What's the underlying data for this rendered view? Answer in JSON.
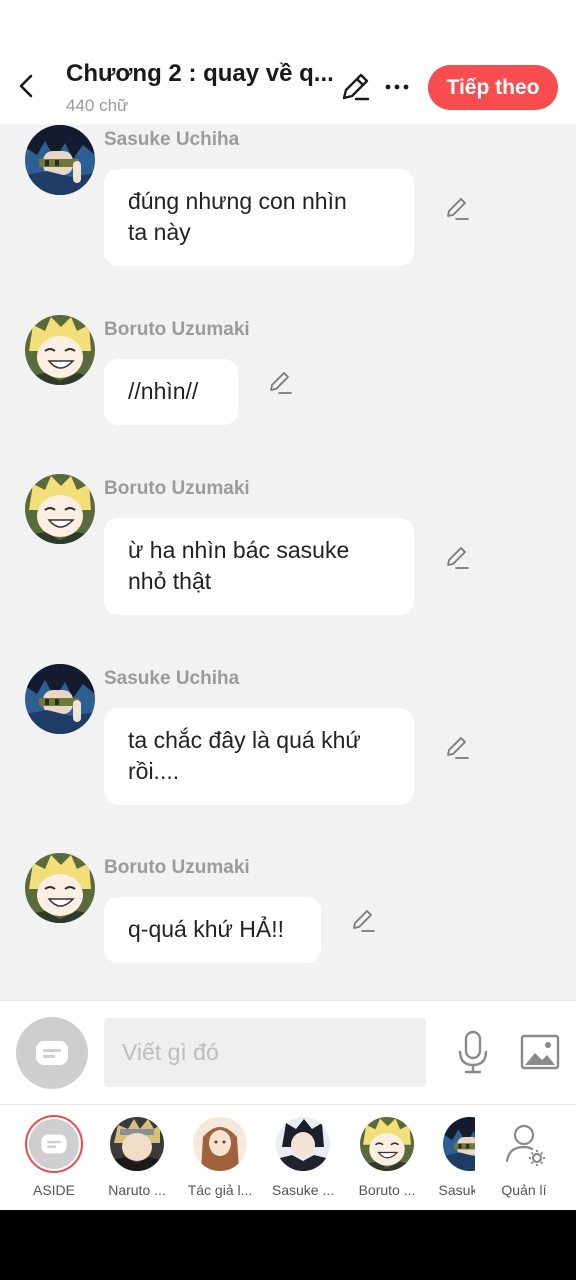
{
  "header": {
    "title": "Chương 2 : quay về q...",
    "word_count": "440 chữ",
    "next_label": "Tiếp theo",
    "accent_color": "#f74d4f"
  },
  "messages": [
    {
      "sender": "Sasuke Uchiha",
      "text": "đúng nhưng con nhìn\nta này",
      "avatar": "sasuke"
    },
    {
      "sender": "Boruto Uzumaki",
      "text": "//nhìn//",
      "avatar": "boruto"
    },
    {
      "sender": "Boruto Uzumaki",
      "text": "ừ ha nhìn bác sasuke\nnhỏ thật",
      "avatar": "boruto"
    },
    {
      "sender": "Sasuke Uchiha",
      "text": "ta chắc đây là quá khứ\nrồi....",
      "avatar": "sasuke"
    },
    {
      "sender": "Boruto Uzumaki",
      "text": "q-quá khứ HẢ!!",
      "avatar": "boruto"
    }
  ],
  "composer": {
    "placeholder": "Viết gì đó"
  },
  "characters": [
    {
      "label": "ASIDE",
      "avatar": "aside"
    },
    {
      "label": "Naruto ...",
      "avatar": "naruto"
    },
    {
      "label": "Tác giả l...",
      "avatar": "author"
    },
    {
      "label": "Sasuke ...",
      "avatar": "sasuke-adult"
    },
    {
      "label": "Boruto ...",
      "avatar": "boruto"
    },
    {
      "label": "Sasuk",
      "avatar": "sasuke"
    },
    {
      "label": "Quản lí",
      "avatar": "manage-icon"
    }
  ]
}
